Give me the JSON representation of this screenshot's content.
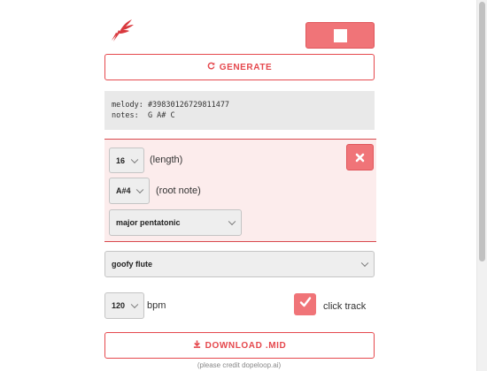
{
  "brand": {
    "logo_icon": "winged-logo-icon",
    "accent": "#e5484d"
  },
  "toolbar": {
    "stop_icon": "stop-icon"
  },
  "generate": {
    "icon": "refresh-icon",
    "label": "GENERATE"
  },
  "melody_info": {
    "melody_line": "melody: #39830126729811477",
    "notes_line": "notes:  G A# C"
  },
  "settings": {
    "length": {
      "value": "16",
      "label": "(length)"
    },
    "root_note": {
      "value": "A#4",
      "label": "(root note)"
    },
    "scale": {
      "value": "major pentatonic"
    },
    "close_icon": "close-icon"
  },
  "instrument": {
    "value": "goofy flute"
  },
  "tempo": {
    "value": "120",
    "label": "bpm"
  },
  "click_track": {
    "checked": true,
    "label": "click track"
  },
  "download": {
    "icon": "download-icon",
    "label": "DOWNLOAD .MID"
  },
  "credit": "(please credit dopeloop.ai)"
}
